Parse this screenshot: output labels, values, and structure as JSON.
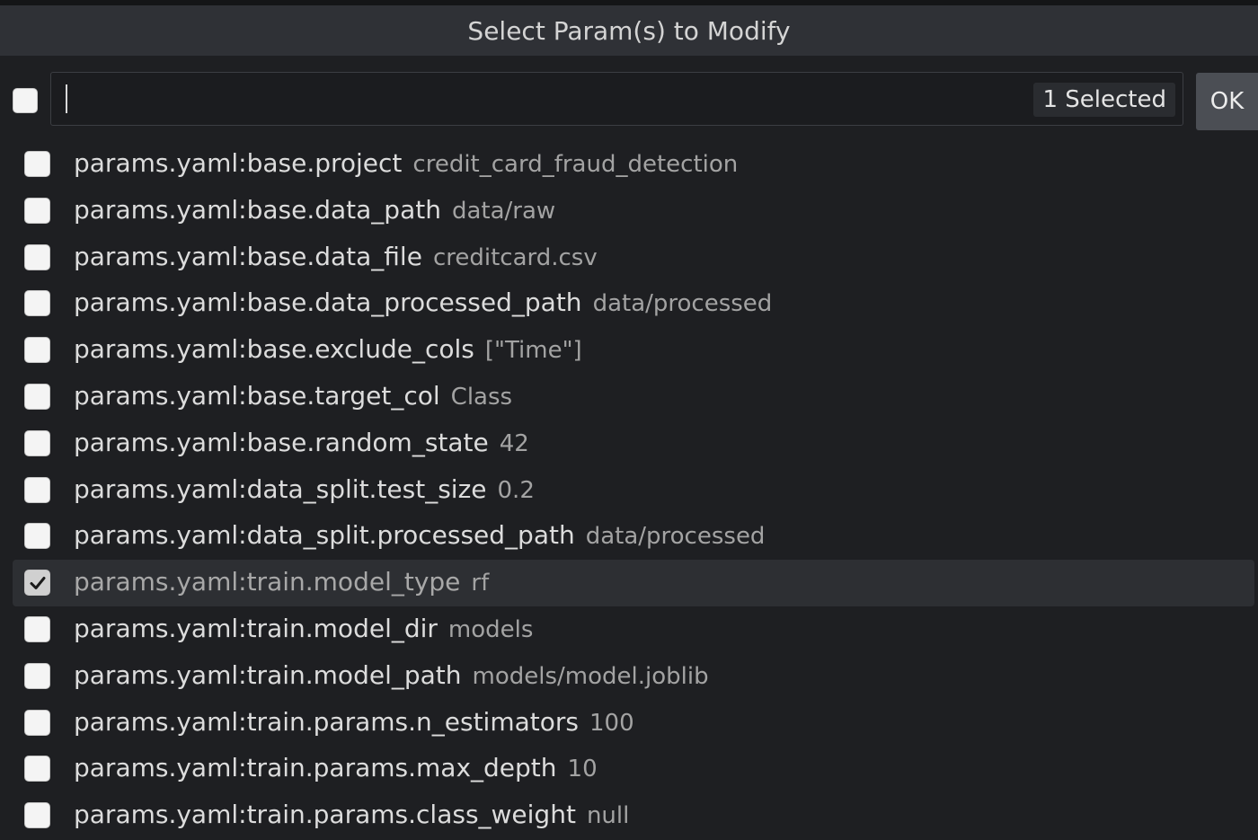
{
  "dialog": {
    "title": "Select Param(s) to Modify"
  },
  "filter": {
    "value": "",
    "placeholder": "",
    "selected_count": "1 Selected",
    "ok_label": "OK"
  },
  "items": [
    {
      "name": "params.yaml:base.project",
      "value": "credit_card_fraud_detection",
      "checked": false
    },
    {
      "name": "params.yaml:base.data_path",
      "value": "data/raw",
      "checked": false
    },
    {
      "name": "params.yaml:base.data_file",
      "value": "creditcard.csv",
      "checked": false
    },
    {
      "name": "params.yaml:base.data_processed_path",
      "value": "data/processed",
      "checked": false
    },
    {
      "name": "params.yaml:base.exclude_cols",
      "value": "[\"Time\"]",
      "checked": false
    },
    {
      "name": "params.yaml:base.target_col",
      "value": "Class",
      "checked": false
    },
    {
      "name": "params.yaml:base.random_state",
      "value": "42",
      "checked": false
    },
    {
      "name": "params.yaml:data_split.test_size",
      "value": "0.2",
      "checked": false
    },
    {
      "name": "params.yaml:data_split.processed_path",
      "value": "data/processed",
      "checked": false
    },
    {
      "name": "params.yaml:train.model_type",
      "value": "rf",
      "checked": true
    },
    {
      "name": "params.yaml:train.model_dir",
      "value": "models",
      "checked": false
    },
    {
      "name": "params.yaml:train.model_path",
      "value": "models/model.joblib",
      "checked": false
    },
    {
      "name": "params.yaml:train.params.n_estimators",
      "value": "100",
      "checked": false
    },
    {
      "name": "params.yaml:train.params.max_depth",
      "value": "10",
      "checked": false
    },
    {
      "name": "params.yaml:train.params.class_weight",
      "value": "null",
      "checked": false
    }
  ]
}
